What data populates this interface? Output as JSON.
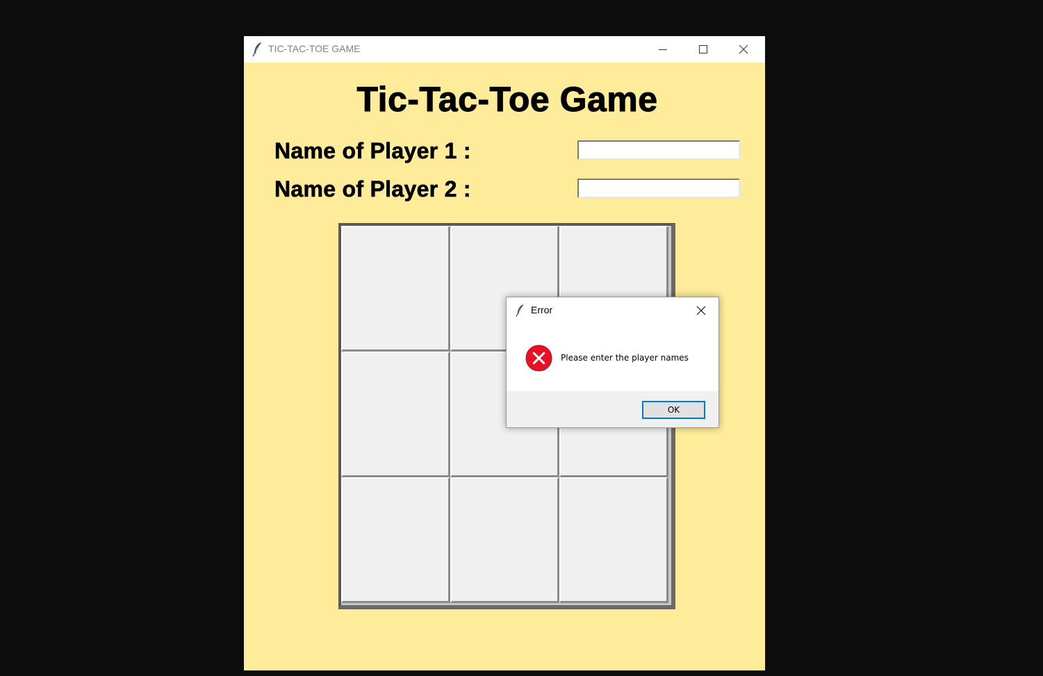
{
  "window": {
    "title": "TIC-TAC-TOE GAME",
    "background_color": "#feec9a"
  },
  "main": {
    "heading": "Tic-Tac-Toe Game",
    "player1_label": "Name of Player 1 :",
    "player2_label": "Name of Player 2 :",
    "player1_value": "",
    "player2_value": ""
  },
  "board": {
    "cells": [
      "",
      "",
      "",
      "",
      "",
      "",
      "",
      "",
      ""
    ]
  },
  "dialog": {
    "title": "Error",
    "message": "Please enter the player names",
    "ok_label": "OK",
    "icon": "error-icon",
    "icon_color": "#e81123"
  }
}
